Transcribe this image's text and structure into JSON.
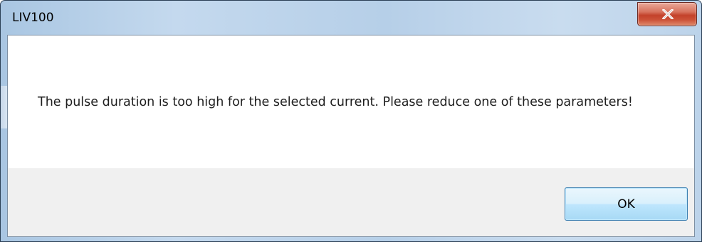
{
  "window": {
    "title": "LIV100"
  },
  "titlebar": {
    "close_icon": "close-x-icon"
  },
  "message": {
    "text": "The pulse duration is too high for the selected current. Please reduce one of these parameters!"
  },
  "buttons": {
    "ok_label": "OK"
  },
  "colors": {
    "close_button": "#c3422b",
    "ok_border": "#3c7fb1",
    "button_area": "#f0f0f0"
  }
}
